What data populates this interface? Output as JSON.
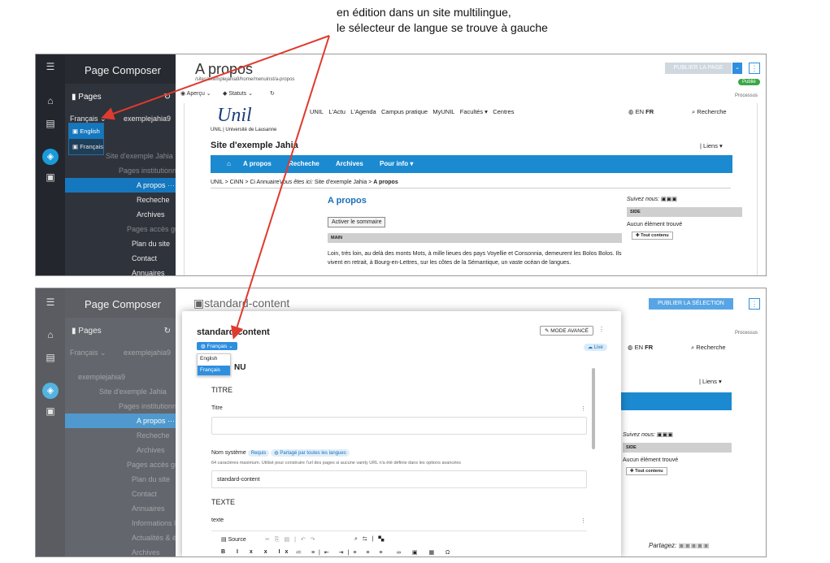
{
  "caption": [
    "en édition dans un site multilingue,",
    "le sélecteur de langue se trouve à gauche"
  ],
  "colors": {
    "accent": "#1b8ad0",
    "arrow": "#e03a2e",
    "published": "#3aa845",
    "sidebar": "#2f333b",
    "rail": "#23262d"
  },
  "shot1": {
    "app_title": "Page Composer",
    "pages_label": "Pages",
    "lang_select": "Français",
    "site_select": "exemplejahia9",
    "lang_options": [
      "English",
      "Français"
    ],
    "tree": [
      "Site d'exemple Jahia",
      "Pages institutionn",
      "A propos",
      "Recheche",
      "Archives",
      "Pages accès guide",
      "Plan du site",
      "Contact",
      "Annuaires"
    ],
    "page_title": "A propos",
    "page_path": "/sites/exemplejahia9/home/menuinst/a-propos",
    "publish_btn": "PUBLIER LA PAGE",
    "status_badge": "Publié",
    "processus": "Processus",
    "toolbar": {
      "preview": "Aperçu",
      "status": "Statuts"
    },
    "site": {
      "logo": "Unil",
      "logo_sub": "UNIL | Université de Lausanne",
      "topnav": [
        "UNIL",
        "L'Actu",
        "L'Agenda",
        "Campus pratique",
        "MyUNIL",
        "Facultés ▾",
        "Centres"
      ],
      "lang": "EN",
      "lang_active": "FR",
      "search": "Recherche",
      "site_name": "Site d'exemple Jahia",
      "liens": "| Liens ▾",
      "nav": [
        "A propos",
        "Recheche",
        "Archives",
        "Pour info ▾"
      ],
      "breadcrumb_pre": "UNIL > CiNN > Ci Annuaire",
      "breadcrumb_ital": "Vous êtes ici:",
      "breadcrumb_site": "Site d'exemple Jahia >",
      "breadcrumb_current": "A propos",
      "heading": "A propos",
      "summary_btn": "Activer le sommaire",
      "main_area": "MAIN",
      "body": "Loin, très loin, au delà des monts Mots, à mille lieues des pays Voyellie et Consonnia, demeurent les Bolos Bolos. Ils vivent en retrait, à Bourg-en-Lettres, sur les côtes de la Sémantique, un vaste océan de langues.",
      "follow": "Suivez nous:",
      "side_area": "SIDE",
      "no_item": "Aucun élément trouvé",
      "all_content": "Tout contenu"
    }
  },
  "shot2": {
    "app_title": "Page Composer",
    "pages_label": "Pages",
    "lang_select": "Français",
    "site_select": "exemplejahia9",
    "tree": [
      "exemplejahia9",
      "Site d'exemple Jahia",
      "Pages institutionn",
      "A propos",
      "Recheche",
      "Archives",
      "Pages accès guide",
      "Plan du site",
      "Contact",
      "Annuaires",
      "Informations légal",
      "Actualités & événe",
      "Archives"
    ],
    "title": "standard-content",
    "publish_btn": "PUBLIER LA SÉLECTION",
    "processus": "Processus",
    "bg": {
      "lang": "EN",
      "lang_active": "FR",
      "search": "Recherche",
      "liens": "| Liens ▾",
      "follow": "Suivez nous:",
      "side": "SIDE",
      "no_item": "Aucun élément trouvé",
      "all_content": "Tout contenu",
      "share": "Partagez:"
    },
    "modal": {
      "title": "standard-content",
      "advanced_btn": "MODE AVANCÉ",
      "lang_btn": "Français",
      "lang_options": [
        "English",
        "Français"
      ],
      "live": "Live",
      "section_partial": "NU",
      "section_title": "TITRE",
      "title_label": "Titre",
      "system_label": "Nom système",
      "required": "Requis",
      "shared": "Partagé par toutes les langues",
      "system_help": "64 caractères maximum. Utilisé pour construire l'url des pages si aucune vanity URL n'a été définie dans les options avancées",
      "system_value": "standard-content",
      "text_section": "TEXTE",
      "text_label": "texte",
      "source": "Source"
    }
  }
}
